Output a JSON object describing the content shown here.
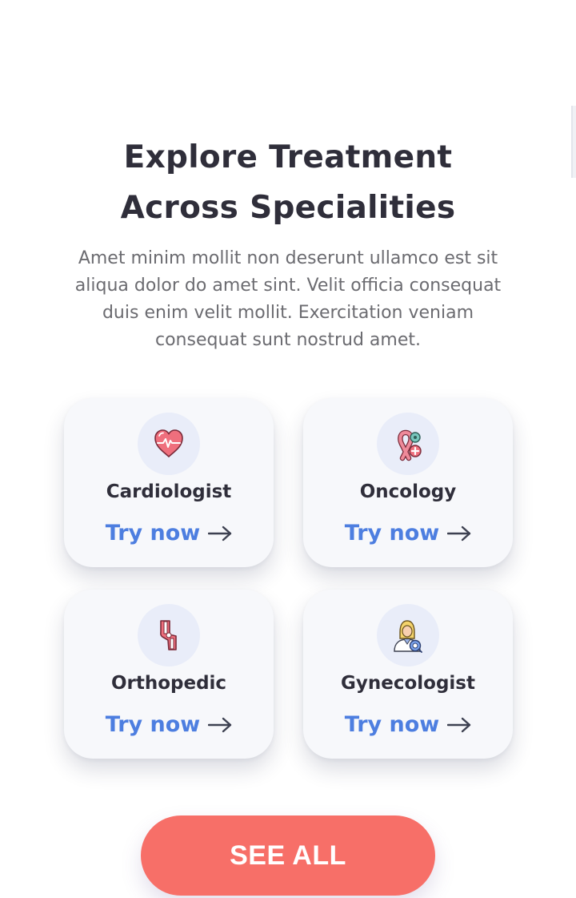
{
  "section": {
    "title_line1": "Explore Treatment",
    "title_line2": "Across Specialities",
    "description": "Amet minim mollit non deserunt ullamco est sit aliqua dolor do amet sint. Velit officia consequat duis enim velit mollit. Exercitation veniam consequat sunt nostrud amet."
  },
  "cards": [
    {
      "title": "Cardiologist",
      "icon": "heart-pulse-icon",
      "link_label": "Try now"
    },
    {
      "title": "Oncology",
      "icon": "cancer-ribbon-icon",
      "link_label": "Try now"
    },
    {
      "title": "Orthopedic",
      "icon": "knee-joint-icon",
      "link_label": "Try now"
    },
    {
      "title": "Gynecologist",
      "icon": "female-doctor-icon",
      "link_label": "Try now"
    }
  ],
  "cta": {
    "label": "SEE ALL"
  },
  "colors": {
    "heading": "#2f2e3a",
    "body_text": "#6b6b70",
    "link": "#4d7ee0",
    "card_bg": "#f7f8fb",
    "icon_circle": "#e9edf9",
    "cta_bg": "#f76f68",
    "cta_text": "#ffffff"
  }
}
